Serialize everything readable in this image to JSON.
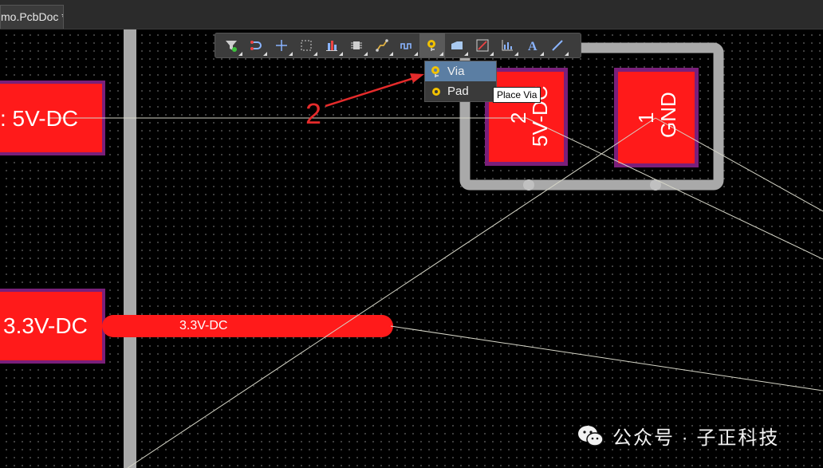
{
  "tab": {
    "title": "mo.PcbDoc *"
  },
  "pads": {
    "left_top_label": ": 5V-DC",
    "left_bottom_label": "3.3V-DC",
    "trace_label": "3.3V-DC",
    "pad2_number": "2",
    "pad2_net": "5V-DC",
    "pad1_number": "1",
    "pad1_net": "GND"
  },
  "annotation": {
    "step": "2"
  },
  "toolbar": {
    "tools": [
      "filter-icon",
      "route-icon",
      "crosshair-icon",
      "select-rect-icon",
      "align-icon",
      "component-icon",
      "interactive-route-icon",
      "length-tune-icon",
      "place-via-icon",
      "polygon-icon",
      "dimension-icon",
      "graph-icon",
      "text-icon",
      "line-icon"
    ],
    "active_tool": "place-via-icon"
  },
  "dropdown": {
    "items": [
      {
        "label": "Via",
        "icon": "via-icon",
        "highlighted": true
      },
      {
        "label": "Pad",
        "icon": "pad-icon",
        "highlighted": false
      }
    ]
  },
  "tooltip": {
    "text": "Place Via"
  },
  "watermark": {
    "text": "公众号 · 子正科技"
  },
  "colors": {
    "pad_fill": "#ff1a1a",
    "pad_border": "#7a1f7a",
    "board_outline": "#a9a9a9",
    "ratsnest": "#d6d6c8",
    "annotation": "#e52b2b",
    "menu_highlight": "#5b7ea3"
  }
}
